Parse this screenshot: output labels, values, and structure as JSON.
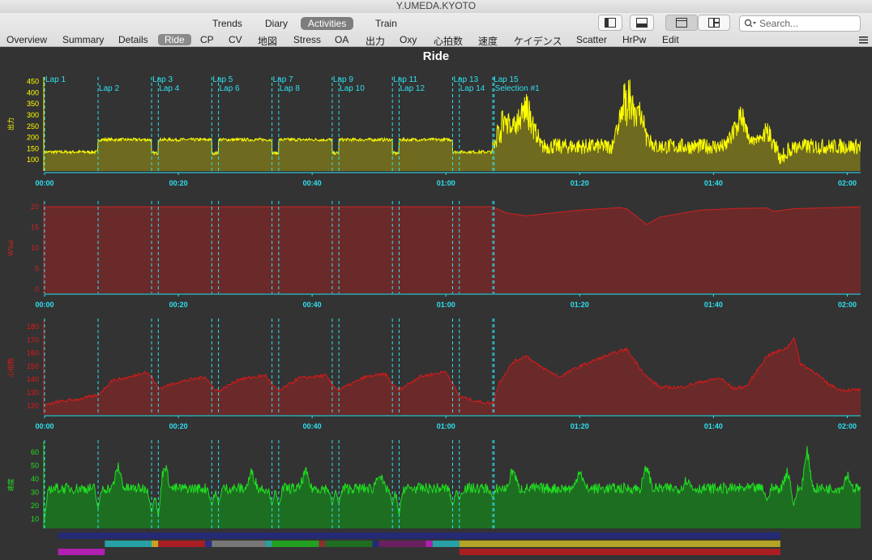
{
  "window": {
    "title": "Y.UMEDA.KYOTO"
  },
  "views": [
    {
      "label": "Trends",
      "active": false
    },
    {
      "label": "Diary",
      "active": false
    },
    {
      "label": "Activities",
      "active": true
    },
    {
      "label": "Train",
      "active": false
    }
  ],
  "search": {
    "placeholder": "Search..."
  },
  "tabs": [
    {
      "label": "Overview"
    },
    {
      "label": "Summary"
    },
    {
      "label": "Details"
    },
    {
      "label": "Ride",
      "active": true
    },
    {
      "label": "CP"
    },
    {
      "label": "CV"
    },
    {
      "label": "地図"
    },
    {
      "label": "Stress"
    },
    {
      "label": "OA"
    },
    {
      "label": "出力"
    },
    {
      "label": "Oxy"
    },
    {
      "label": "心拍数"
    },
    {
      "label": "速度"
    },
    {
      "label": "ケイデンス"
    },
    {
      "label": "Scatter"
    },
    {
      "label": "HrPw"
    },
    {
      "label": "Edit"
    }
  ],
  "chart_title": "Ride",
  "icons": {
    "layout_single": "sidebar-toggle-icon",
    "layout_bottom": "bottom-panel-icon",
    "style_tabbed": "tabbed-view-icon",
    "style_tiled": "tiled-view-icon",
    "search": "search-icon",
    "menu": "hamburger-menu-icon"
  },
  "chart_data": {
    "type": "line",
    "x_unit": "time (h:mm)",
    "x_ticks": [
      "00:00",
      "00:20",
      "00:40",
      "01:00",
      "01:20",
      "01:40",
      "02:00"
    ],
    "x_range_min": [
      0,
      122
    ],
    "laps": [
      {
        "name": "Lap 1",
        "start_min": 0
      },
      {
        "name": "Lap 2",
        "start_min": 8
      },
      {
        "name": "Lap 3",
        "start_min": 16
      },
      {
        "name": "Lap 4",
        "start_min": 17
      },
      {
        "name": "Lap 5",
        "start_min": 25
      },
      {
        "name": "Lap 6",
        "start_min": 26
      },
      {
        "name": "Lap 7",
        "start_min": 34
      },
      {
        "name": "Lap 8",
        "start_min": 35
      },
      {
        "name": "Lap 9",
        "start_min": 43
      },
      {
        "name": "Lap 10",
        "start_min": 44
      },
      {
        "name": "Lap 11",
        "start_min": 52
      },
      {
        "name": "Lap 12",
        "start_min": 53
      },
      {
        "name": "Lap 13",
        "start_min": 61
      },
      {
        "name": "Lap 14",
        "start_min": 62
      },
      {
        "name": "Lap 15",
        "start_min": 67
      },
      {
        "name": "Selection #1",
        "start_min": 67.2
      }
    ],
    "panels": [
      {
        "name": "power",
        "ylabel": "出力",
        "color": "#ffff00",
        "fill": "#6e6a1f",
        "y_ticks": [
          100,
          150,
          200,
          250,
          300,
          350,
          400,
          450
        ],
        "ylim": [
          50,
          470
        ],
        "segments": [
          {
            "x": [
              0,
              8
            ],
            "level": 135
          },
          {
            "x": [
              8,
              16
            ],
            "level": 190
          },
          {
            "x": [
              16,
              17
            ],
            "level": 130
          },
          {
            "x": [
              17,
              25
            ],
            "level": 190
          },
          {
            "x": [
              25,
              26
            ],
            "level": 130
          },
          {
            "x": [
              26,
              34
            ],
            "level": 190
          },
          {
            "x": [
              34,
              35
            ],
            "level": 130
          },
          {
            "x": [
              35,
              43
            ],
            "level": 190
          },
          {
            "x": [
              43,
              44
            ],
            "level": 130
          },
          {
            "x": [
              44,
              52
            ],
            "level": 190
          },
          {
            "x": [
              52,
              53
            ],
            "level": 130
          },
          {
            "x": [
              53,
              61
            ],
            "level": 190
          },
          {
            "x": [
              61,
              62
            ],
            "level": 135
          },
          {
            "x": [
              62,
              67
            ],
            "level": 135
          }
        ],
        "free_ride": {
          "x": [
            67,
            122
          ],
          "baseline": 160,
          "peaks": [
            [
              69,
              330
            ],
            [
              72,
              380
            ],
            [
              87,
              420
            ],
            [
              89,
              300
            ],
            [
              104,
              310
            ],
            [
              108,
              250
            ],
            [
              110,
              100
            ]
          ]
        }
      },
      {
        "name": "w_bal",
        "ylabel": "W'bal",
        "color": "#d42020",
        "fill": "#6a2a2a",
        "y_ticks": [
          0,
          5,
          10,
          15,
          20
        ],
        "ylim": [
          -1,
          21
        ],
        "points": [
          [
            0,
            20
          ],
          [
            67,
            20
          ],
          [
            69,
            18.5
          ],
          [
            72,
            17.8
          ],
          [
            80,
            19.2
          ],
          [
            86,
            19.8
          ],
          [
            87,
            19.5
          ],
          [
            89,
            17
          ],
          [
            90,
            15.7
          ],
          [
            92,
            17.5
          ],
          [
            98,
            19.2
          ],
          [
            104,
            19.6
          ],
          [
            108,
            19.7
          ],
          [
            109,
            18.9
          ],
          [
            112,
            19.5
          ],
          [
            122,
            20
          ]
        ]
      },
      {
        "name": "heart_rate",
        "ylabel": "心拍数",
        "color": "#e01818",
        "fill": "#6a2a2a",
        "y_ticks": [
          120,
          130,
          140,
          150,
          160,
          170,
          180
        ],
        "ylim": [
          113,
          185
        ],
        "points": [
          [
            0,
            120
          ],
          [
            2,
            123
          ],
          [
            5,
            125
          ],
          [
            8,
            128
          ],
          [
            10,
            139
          ],
          [
            13,
            142
          ],
          [
            15,
            146
          ],
          [
            16,
            142
          ],
          [
            17,
            133
          ],
          [
            20,
            138
          ],
          [
            24,
            142
          ],
          [
            25,
            135
          ],
          [
            26,
            131
          ],
          [
            29,
            140
          ],
          [
            33,
            143
          ],
          [
            34,
            136
          ],
          [
            35,
            131
          ],
          [
            38,
            141
          ],
          [
            42,
            143
          ],
          [
            43,
            136
          ],
          [
            44,
            132
          ],
          [
            48,
            142
          ],
          [
            51,
            144
          ],
          [
            52,
            136
          ],
          [
            53,
            132
          ],
          [
            56,
            142
          ],
          [
            60,
            146
          ],
          [
            61,
            137
          ],
          [
            62,
            127
          ],
          [
            65,
            123
          ],
          [
            67,
            122
          ],
          [
            68,
            138
          ],
          [
            70,
            153
          ],
          [
            72,
            158
          ],
          [
            74,
            150
          ],
          [
            77,
            142
          ],
          [
            80,
            150
          ],
          [
            84,
            158
          ],
          [
            87,
            163
          ],
          [
            90,
            142
          ],
          [
            92,
            134
          ],
          [
            95,
            134
          ],
          [
            98,
            138
          ],
          [
            101,
            141
          ],
          [
            103,
            133
          ],
          [
            105,
            135
          ],
          [
            108,
            158
          ],
          [
            111,
            164
          ],
          [
            112,
            172
          ],
          [
            113,
            152
          ],
          [
            115,
            146
          ],
          [
            117,
            137
          ],
          [
            119,
            132
          ],
          [
            122,
            132
          ]
        ]
      },
      {
        "name": "speed",
        "ylabel": "速度",
        "color": "#20e020",
        "fill": "#1e6e22",
        "y_ticks": [
          10,
          20,
          30,
          40,
          50,
          60
        ],
        "ylim": [
          3,
          68
        ],
        "baseline": 33,
        "dips": [
          [
            0,
            10
          ],
          [
            8,
            18
          ],
          [
            16,
            15
          ],
          [
            17,
            12
          ],
          [
            25,
            20
          ],
          [
            26,
            22
          ],
          [
            34,
            21
          ],
          [
            35,
            20
          ],
          [
            43,
            21
          ],
          [
            44,
            22
          ],
          [
            52,
            21
          ],
          [
            53,
            13
          ],
          [
            61,
            20
          ],
          [
            62,
            25
          ],
          [
            67,
            26
          ],
          [
            108,
            24
          ],
          [
            112,
            20
          ]
        ],
        "spikes": [
          [
            11,
            50
          ],
          [
            18,
            51
          ],
          [
            31,
            46
          ],
          [
            39,
            46
          ],
          [
            50,
            45
          ],
          [
            70,
            48
          ],
          [
            80,
            48
          ],
          [
            90,
            50
          ],
          [
            96,
            40
          ],
          [
            111,
            46
          ],
          [
            114,
            61
          ],
          [
            120,
            44
          ]
        ]
      }
    ],
    "zone_bars": [
      {
        "row": 0,
        "x": [
          2,
          110
        ],
        "color": "#252a75"
      },
      {
        "row": 1,
        "x": [
          9,
          16
        ],
        "color": "#27a0a6"
      },
      {
        "row": 1,
        "x": [
          16,
          17
        ],
        "color": "#c7a326"
      },
      {
        "row": 1,
        "x": [
          17,
          24
        ],
        "color": "#a91e22"
      },
      {
        "row": 1,
        "x": [
          24,
          25
        ],
        "color": "#2a2d8a"
      },
      {
        "row": 1,
        "x": [
          25,
          33
        ],
        "color": "#777777"
      },
      {
        "row": 1,
        "x": [
          33,
          34
        ],
        "color": "#2aa0a0"
      },
      {
        "row": 1,
        "x": [
          34,
          41
        ],
        "color": "#22a022"
      },
      {
        "row": 1,
        "x": [
          41,
          42
        ],
        "color": "#8a3030"
      },
      {
        "row": 1,
        "x": [
          42,
          49
        ],
        "color": "#1f6e22"
      },
      {
        "row": 1,
        "x": [
          49,
          50
        ],
        "color": "#252a75"
      },
      {
        "row": 1,
        "x": [
          50,
          57
        ],
        "color": "#6a2060"
      },
      {
        "row": 1,
        "x": [
          57,
          58
        ],
        "color": "#b020b0"
      },
      {
        "row": 1,
        "x": [
          58,
          62
        ],
        "color": "#27a0a6"
      },
      {
        "row": 1,
        "x": [
          62,
          110
        ],
        "color": "#b3a326"
      },
      {
        "row": 2,
        "x": [
          2,
          9
        ],
        "color": "#b020b0"
      },
      {
        "row": 2,
        "x": [
          62,
          110
        ],
        "color": "#a91e22"
      }
    ]
  }
}
